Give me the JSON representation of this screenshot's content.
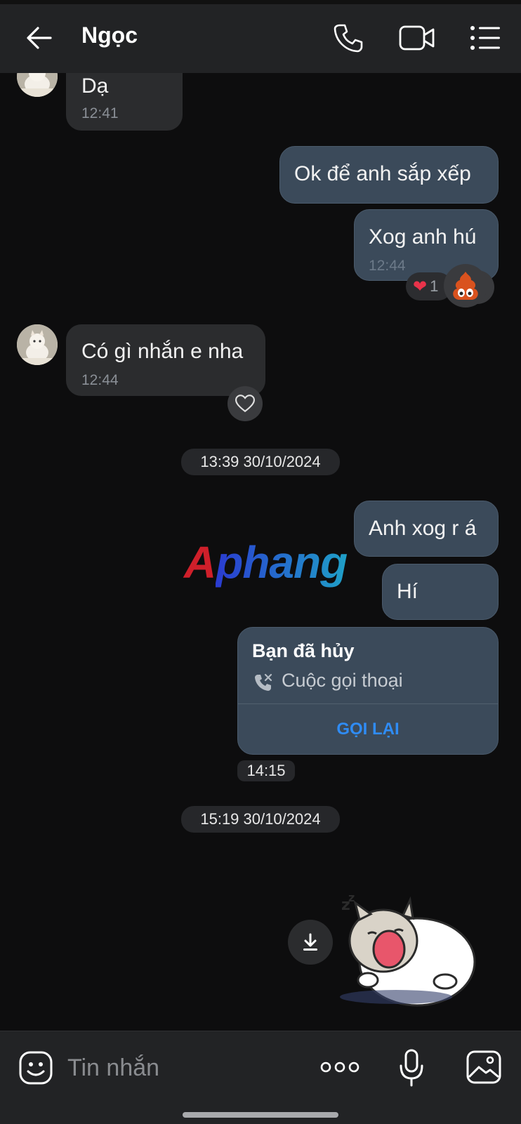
{
  "header": {
    "title": "Ngọc",
    "back_icon": "back-arrow-icon",
    "call_icon": "phone-icon",
    "video_icon": "video-camera-icon",
    "menu_icon": "list-menu-icon"
  },
  "messages": {
    "m1": {
      "text": "Dạ",
      "time": "12:41"
    },
    "m2": {
      "text": "Ok để anh sắp xếp"
    },
    "m3": {
      "text": "Xog anh hú",
      "time": "12:44",
      "reaction_count": "1"
    },
    "m4": {
      "text": "Có gì nhắn e nha",
      "time": "12:44"
    },
    "m5": {
      "text": "Anh xog r á"
    },
    "m6": {
      "text": "Hí"
    }
  },
  "dividers": {
    "d1": "13:39 30/10/2024",
    "d2": "15:19 30/10/2024"
  },
  "call_card": {
    "title": "Bạn đã hủy",
    "subtitle": "Cuộc gọi thoại",
    "action": "GỌI LẠI",
    "time": "14:15"
  },
  "watermark": {
    "part1": "A",
    "part2": "phang"
  },
  "composer": {
    "placeholder": "Tin nhắn",
    "emoji_icon": "sticker-emoji-icon",
    "more_icon": "more-options-icon",
    "mic_icon": "microphone-icon",
    "image_icon": "image-gallery-icon"
  },
  "colors": {
    "background": "#0d0d0e",
    "header": "#222325",
    "incoming_bubble": "#2b2c2e",
    "outgoing_bubble": "#3b4a5a",
    "accent_link": "#2f8cf5"
  }
}
